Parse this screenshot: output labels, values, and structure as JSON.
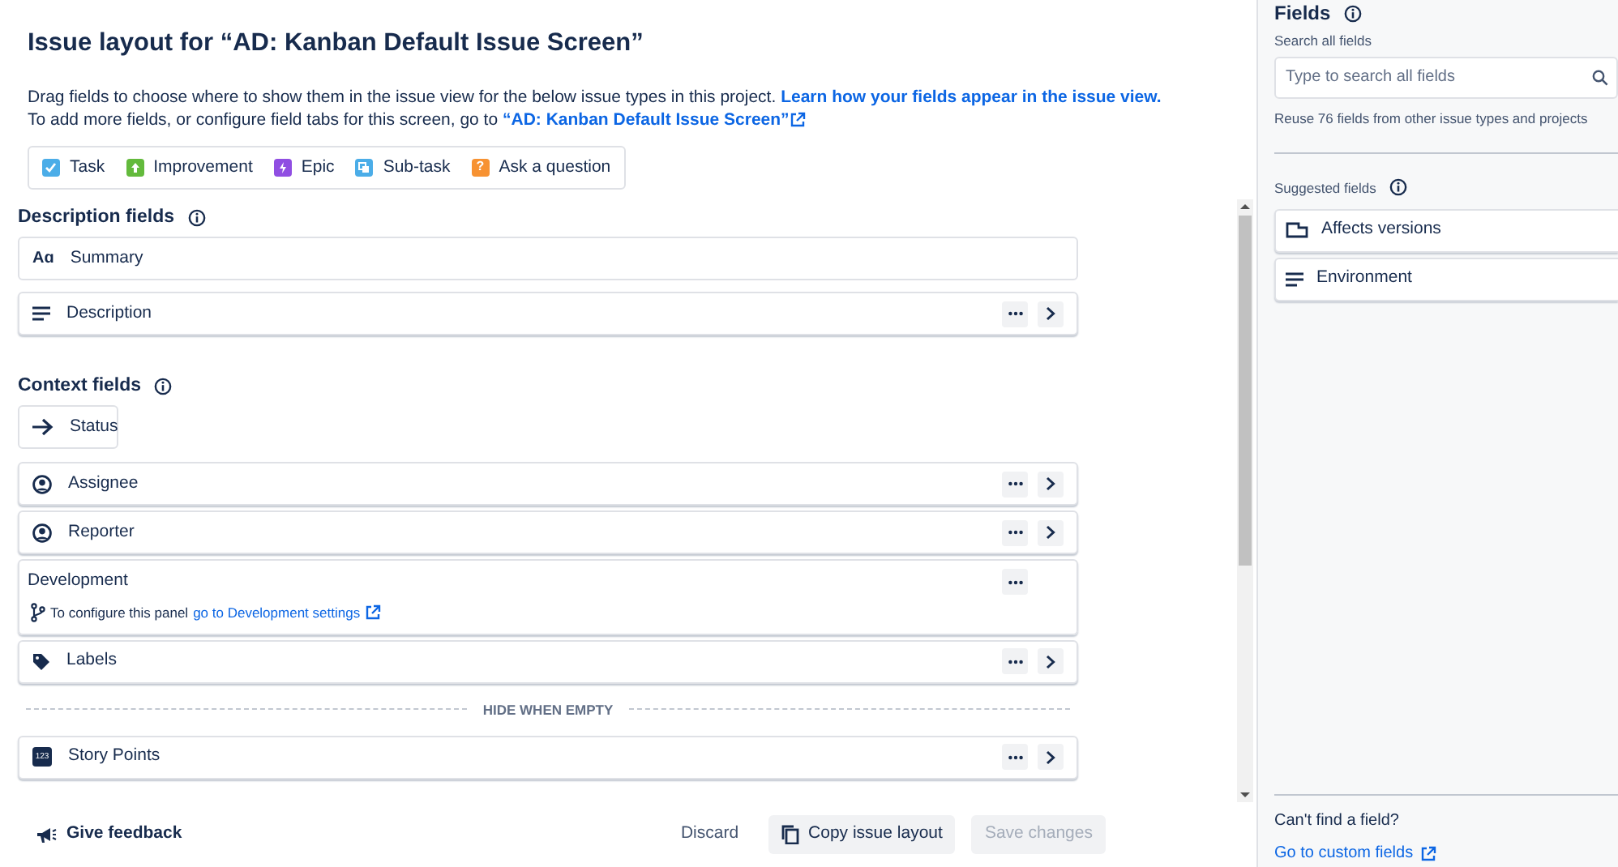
{
  "title": "Issue layout for “AD: Kanban Default Issue Screen”",
  "intro": {
    "text": "Drag fields to choose where to show them in the issue view for the below issue types in this project.",
    "link": "Learn how your fields appear in the issue view."
  },
  "intro_line2": {
    "text": "To add more fields, or configure field tabs for this screen, go to",
    "link": "“AD: Kanban Default Issue Screen”"
  },
  "issue_types": [
    {
      "label": "Task",
      "kind": "check",
      "color": "#4bade8"
    },
    {
      "label": "Improvement",
      "kind": "arrow",
      "color": "#63ba3c"
    },
    {
      "label": "Epic",
      "kind": "bolt",
      "color": "#904ee2"
    },
    {
      "label": "Sub-task",
      "kind": "subtask",
      "color": "#4bade8"
    },
    {
      "label": "Ask a question",
      "kind": "question",
      "color": "#f79232",
      "glyph": "?"
    }
  ],
  "description_fields": {
    "heading": "Description fields",
    "fields": [
      {
        "label": "Summary",
        "kind": "summary",
        "glyph": "Aɑ"
      },
      {
        "label": "Description",
        "kind": "paragraph"
      }
    ]
  },
  "context_fields": {
    "heading": "Context fields",
    "fields": [
      {
        "label": "Status",
        "kind": "status"
      },
      {
        "label": "Assignee",
        "kind": "user"
      },
      {
        "label": "Reporter",
        "kind": "user"
      },
      {
        "label": "Development",
        "kind": "development",
        "note": "To configure this panel",
        "link": "go to Development settings"
      },
      {
        "label": "Labels",
        "kind": "labels"
      }
    ]
  },
  "hide_when_empty": {
    "label": "HIDE WHEN EMPTY",
    "fields": [
      {
        "label": "Story Points",
        "kind": "number",
        "glyph": "123"
      }
    ]
  },
  "footer": {
    "feedback": "Give feedback",
    "discard": "Discard",
    "copy": "Copy issue layout",
    "save": {
      "label": "Save changes",
      "disabled": true
    }
  },
  "sidebar": {
    "title": "Fields",
    "search_label": "Search all fields",
    "search": {
      "placeholder": "Type to search all fields"
    },
    "hint": "Reuse 76 fields from other issue types and projects",
    "suggested_heading": "Suggested fields",
    "suggested": [
      {
        "label": "Affects versions",
        "kind": "versions"
      },
      {
        "label": "Environment",
        "kind": "paragraph"
      }
    ],
    "cant_find": "Can't find a field?",
    "custom_link": "Go to custom fields"
  }
}
